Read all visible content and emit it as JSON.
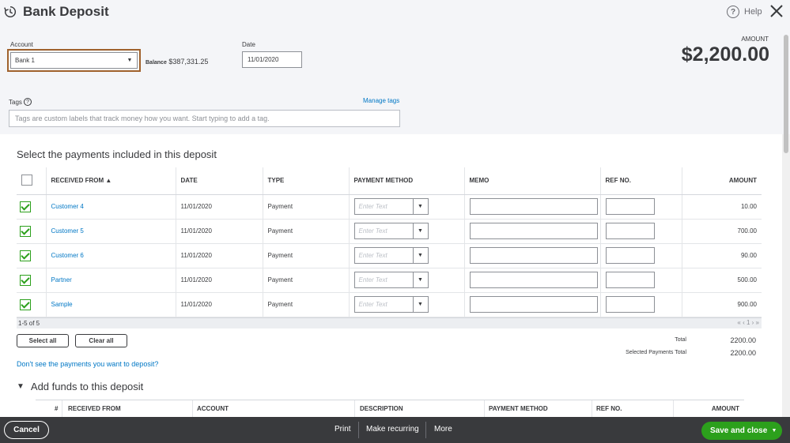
{
  "header": {
    "title": "Bank Deposit",
    "help_label": "Help",
    "icons": [
      "history-icon",
      "help-icon",
      "close-icon"
    ]
  },
  "form": {
    "account_label": "Account",
    "account_value": "Bank 1",
    "balance_label": "Balance",
    "balance_value": "$387,331.25",
    "date_label": "Date",
    "date_value": "11/01/2020",
    "amount_label": "AMOUNT",
    "amount_value": "$2,200.00",
    "tags_label": "Tags",
    "manage_tags": "Manage tags",
    "tags_placeholder": "Tags are custom labels that track money how you want. Start typing to add a tag."
  },
  "payments": {
    "title": "Select the payments included in this deposit",
    "columns": [
      "RECEIVED FROM",
      "DATE",
      "TYPE",
      "PAYMENT METHOD",
      "MEMO",
      "REF NO.",
      "AMOUNT"
    ],
    "sort_indicator": "▲",
    "method_placeholder": "Enter Text",
    "rows": [
      {
        "received_from": "Customer 4",
        "date": "11/01/2020",
        "type": "Payment",
        "amount": "10.00",
        "checked": true
      },
      {
        "received_from": "Customer 5",
        "date": "11/01/2020",
        "type": "Payment",
        "amount": "700.00",
        "checked": true
      },
      {
        "received_from": "Customer 6",
        "date": "11/01/2020",
        "type": "Payment",
        "amount": "90.00",
        "checked": true
      },
      {
        "received_from": "Partner",
        "date": "11/01/2020",
        "type": "Payment",
        "amount": "500.00",
        "checked": true
      },
      {
        "received_from": "Sample",
        "date": "11/01/2020",
        "type": "Payment",
        "amount": "900.00",
        "checked": true
      }
    ],
    "pager_text": "1-5 of 5",
    "pager_nav": "« ‹ 1 › »",
    "select_all": "Select all",
    "clear_all": "Clear all",
    "total_label": "Total",
    "total_value": "2200.00",
    "selected_total_label": "Selected Payments Total",
    "selected_total_value": "2200.00",
    "dont_see": "Don't see the payments you want to deposit?"
  },
  "add_funds": {
    "title": "Add funds to this deposit",
    "columns": [
      "#",
      "RECEIVED FROM",
      "ACCOUNT",
      "DESCRIPTION",
      "PAYMENT METHOD",
      "REF NO.",
      "AMOUNT"
    ]
  },
  "footer": {
    "cancel": "Cancel",
    "print": "Print",
    "make_recurring": "Make recurring",
    "more": "More",
    "save_close": "Save and close"
  },
  "colors": {
    "accent_green": "#2ca01c",
    "link_blue": "#0077c5",
    "focus_border": "#a0622d",
    "footer_bg": "#393a3d"
  }
}
